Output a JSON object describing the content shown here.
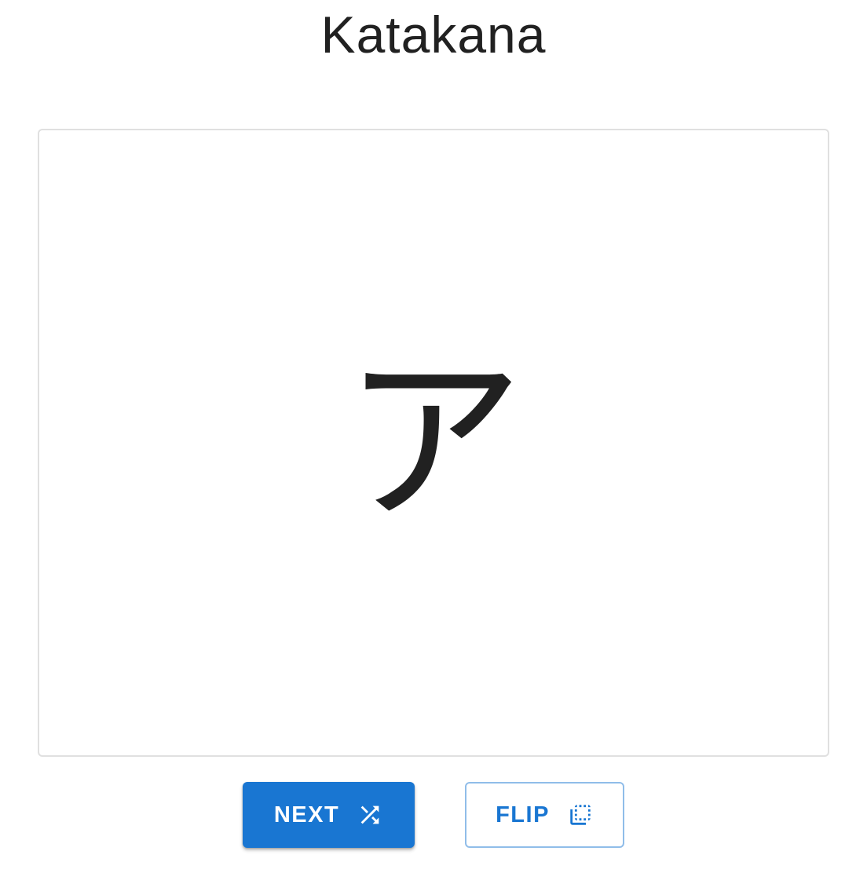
{
  "header": {
    "title": "Katakana"
  },
  "card": {
    "character": "ア"
  },
  "actions": {
    "next_label": "NEXT",
    "next_icon": "shuffle-icon",
    "flip_label": "FLIP",
    "flip_icon": "flip-icon"
  },
  "colors": {
    "primary": "#1976d2",
    "outline": "#90bde9",
    "text": "#212121",
    "card_border": "#e0e0e0"
  }
}
